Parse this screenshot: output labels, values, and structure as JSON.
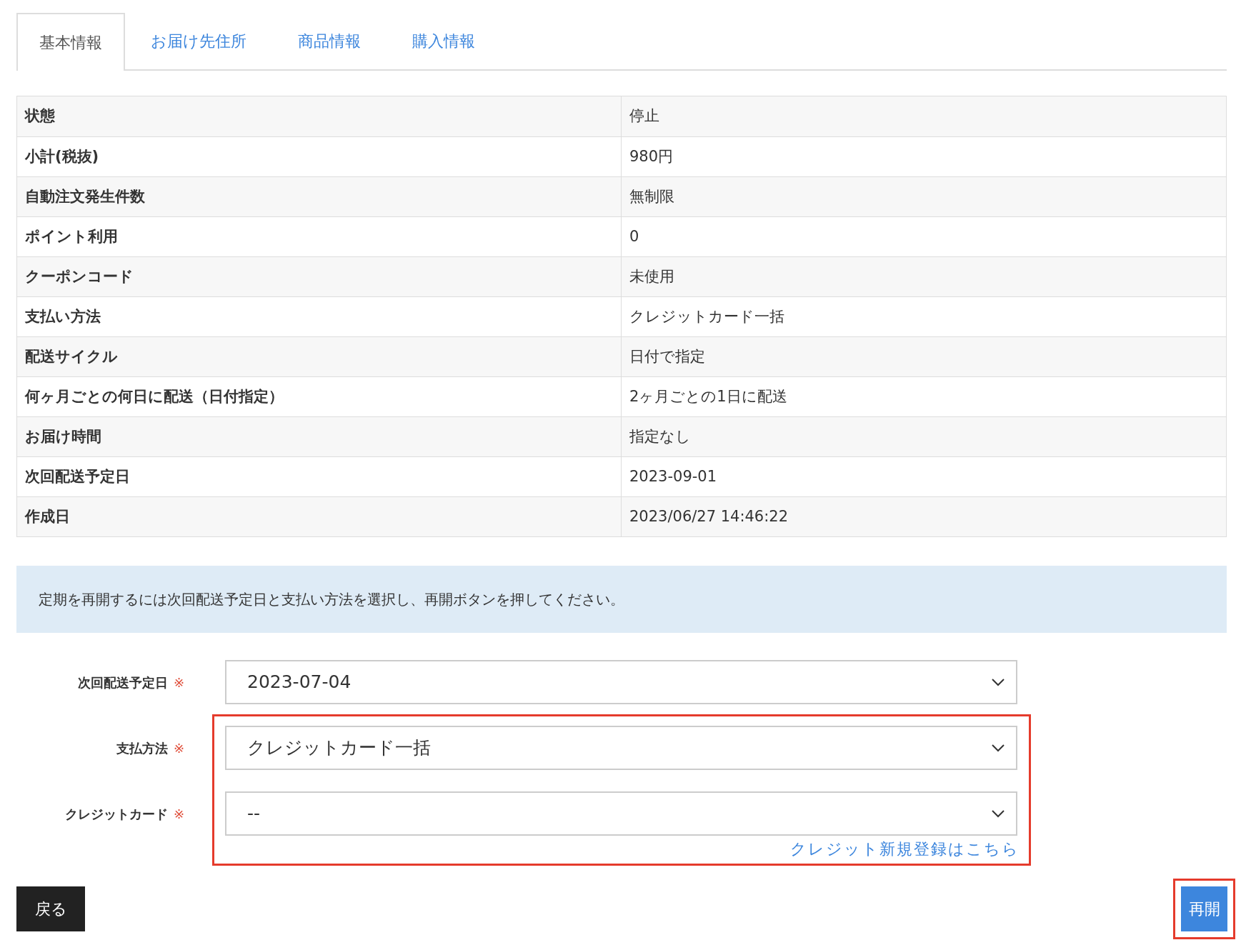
{
  "tabs": [
    {
      "label": "基本情報",
      "selected": true
    },
    {
      "label": "お届け先住所",
      "selected": false
    },
    {
      "label": "商品情報",
      "selected": false
    },
    {
      "label": "購入情報",
      "selected": false
    }
  ],
  "details": [
    {
      "label": "状態",
      "value": "停止"
    },
    {
      "label": "小計(税抜)",
      "value": "980円"
    },
    {
      "label": "自動注文発生件数",
      "value": "無制限"
    },
    {
      "label": "ポイント利用",
      "value": "0"
    },
    {
      "label": "クーポンコード",
      "value": "未使用"
    },
    {
      "label": "支払い方法",
      "value": "クレジットカード一括"
    },
    {
      "label": "配送サイクル",
      "value": "日付で指定"
    },
    {
      "label": "何ヶ月ごとの何日に配送（日付指定）",
      "value": "2ヶ月ごとの1日に配送"
    },
    {
      "label": "お届け時間",
      "value": "指定なし"
    },
    {
      "label": "次回配送予定日",
      "value": "2023-09-01"
    },
    {
      "label": "作成日",
      "value": "2023/06/27 14:46:22"
    }
  ],
  "notice": "定期を再開するには次回配送予定日と支払い方法を選択し、再開ボタンを押してください。",
  "schedule_field": {
    "label": "次回配送予定日",
    "required_mark": "※",
    "value": "2023-07-04"
  },
  "payment_section": {
    "highlighted": true,
    "fields": [
      {
        "label": "支払方法",
        "required_mark": "※",
        "value": "クレジットカード一括"
      },
      {
        "label": "クレジットカード",
        "required_mark": "※",
        "value": "--"
      }
    ],
    "register_link": "クレジット新規登録はこちら"
  },
  "buttons": {
    "back": "戻る",
    "resume": "再開",
    "resume_highlighted": true
  }
}
